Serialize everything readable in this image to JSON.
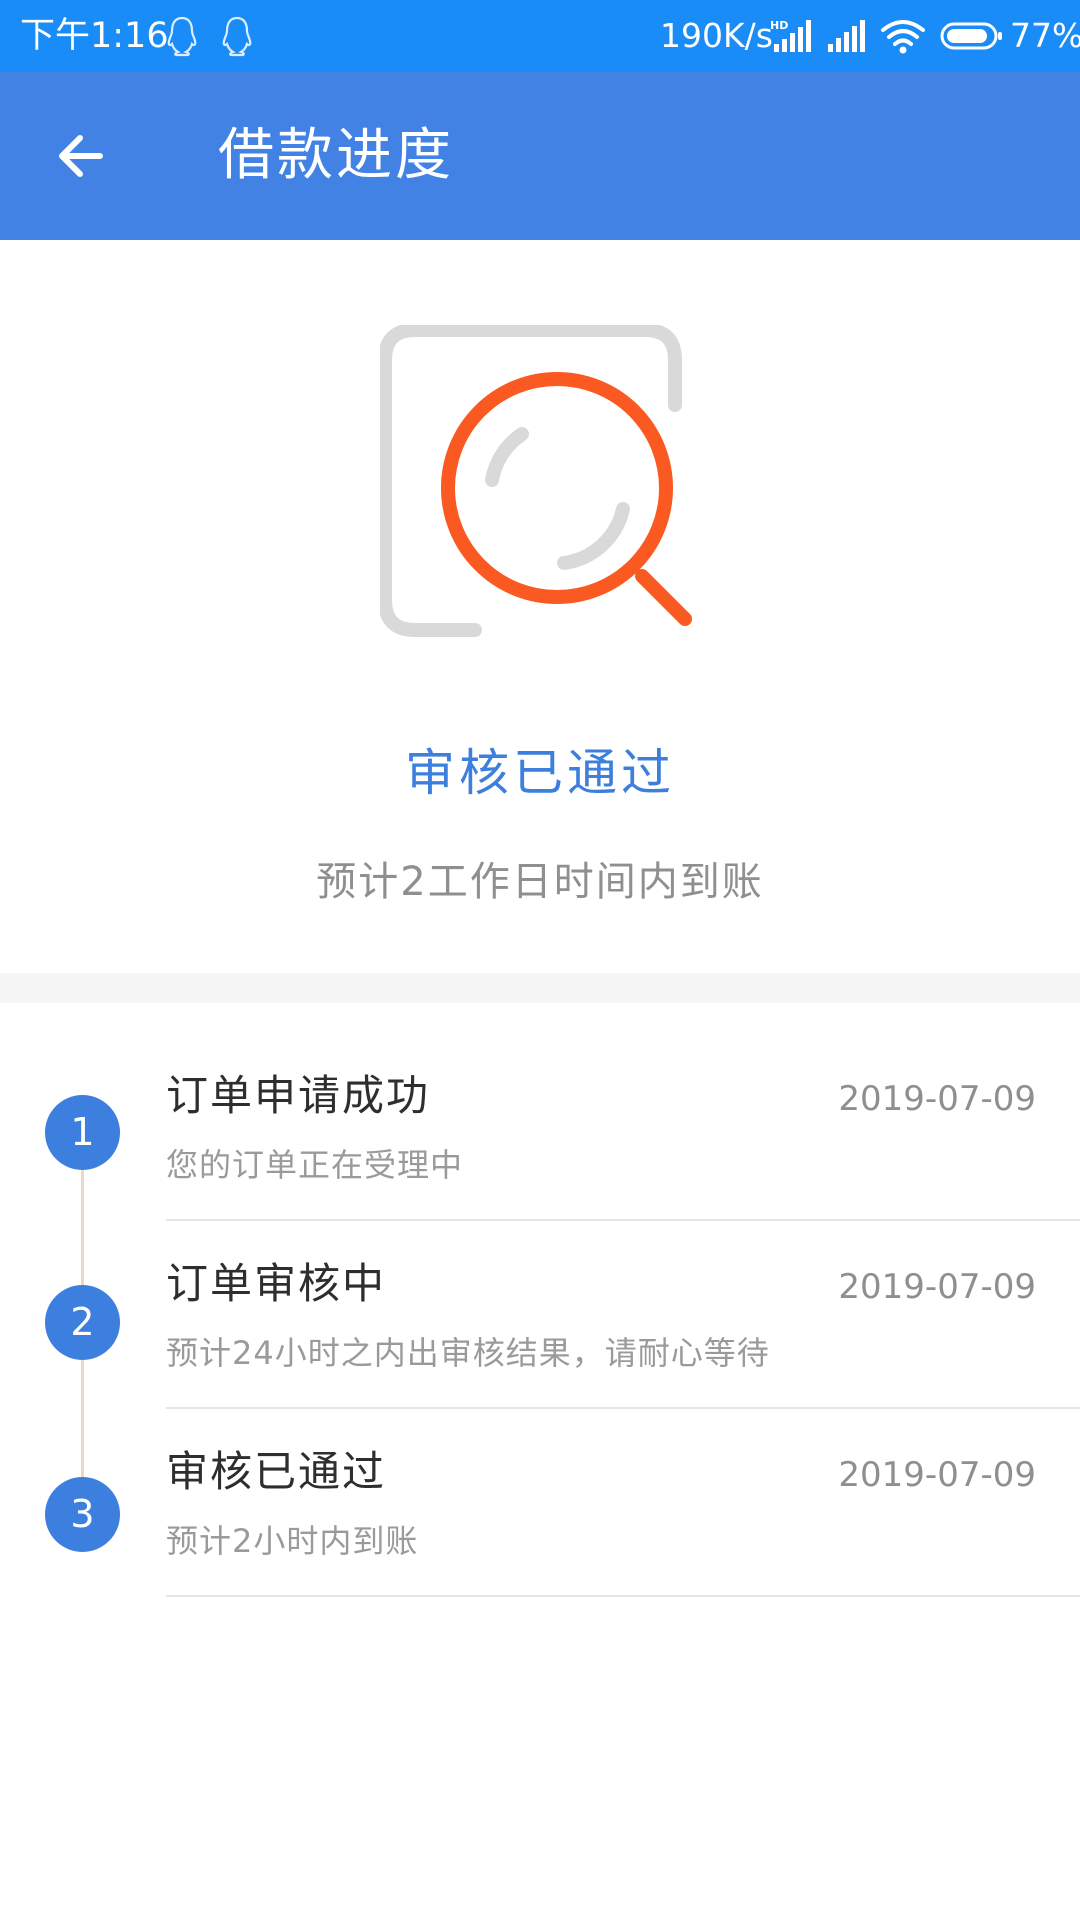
{
  "status_bar": {
    "time": "下午1:16",
    "network_speed": "190K/s",
    "battery": "77%",
    "icons": [
      "qq-icon",
      "qq-icon",
      "hd-signal-icon",
      "signal-icon",
      "wifi-icon",
      "battery-icon"
    ]
  },
  "header": {
    "back_icon": "arrow-left-icon",
    "title": "借款进度"
  },
  "hero": {
    "illustration": "search-review-icon",
    "status": "审核已通过",
    "subtitle": "预计2工作日时间内到账"
  },
  "timeline": {
    "steps": [
      {
        "number": "1",
        "title": "订单申请成功",
        "date": "2019-07-09",
        "description": "您的订单正在受理中"
      },
      {
        "number": "2",
        "title": "订单审核中",
        "date": "2019-07-09",
        "description": "预计24小时之内出审核结果，请耐心等待"
      },
      {
        "number": "3",
        "title": "审核已通过",
        "date": "2019-07-09",
        "description": "预计2小时内到账"
      }
    ]
  },
  "colors": {
    "status_bar": "#1a8cf7",
    "app_bar": "#4382e5",
    "accent": "#3d7fdc",
    "step_circle": "#3d7fdf",
    "magnifier": "#fa5a22",
    "timeline_line": "#f0d7c2"
  }
}
